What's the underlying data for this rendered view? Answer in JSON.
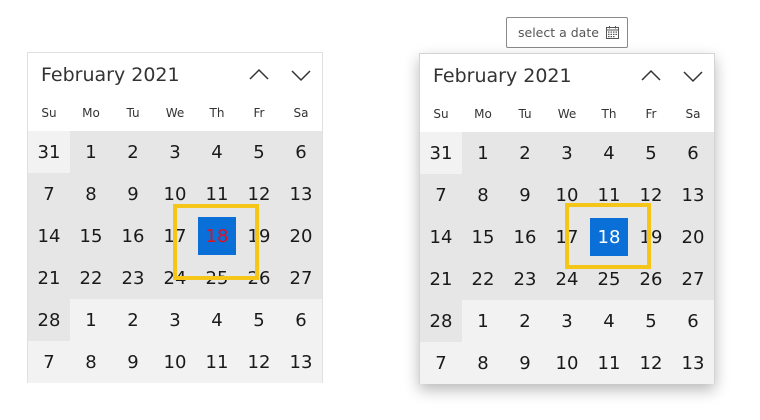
{
  "date_picker": {
    "placeholder": "select a date",
    "icon": "calendar-icon"
  },
  "calendars": [
    {
      "month_title": "February 2021",
      "weekdays": [
        "Su",
        "Mo",
        "Tu",
        "We",
        "Th",
        "Fr",
        "Sa"
      ],
      "days": [
        "31",
        "1",
        "2",
        "3",
        "4",
        "5",
        "6",
        "7",
        "8",
        "9",
        "10",
        "11",
        "12",
        "13",
        "14",
        "15",
        "16",
        "17",
        "18",
        "19",
        "20",
        "21",
        "22",
        "23",
        "24",
        "25",
        "26",
        "27",
        "28",
        "1",
        "2",
        "3",
        "4",
        "5",
        "6",
        "7",
        "8",
        "9",
        "10",
        "11",
        "12",
        "13"
      ],
      "selected": "18",
      "selected_text_color": "#e0101d"
    },
    {
      "month_title": "February 2021",
      "weekdays": [
        "Su",
        "Mo",
        "Tu",
        "We",
        "Th",
        "Fr",
        "Sa"
      ],
      "days": [
        "31",
        "1",
        "2",
        "3",
        "4",
        "5",
        "6",
        "7",
        "8",
        "9",
        "10",
        "11",
        "12",
        "13",
        "14",
        "15",
        "16",
        "17",
        "18",
        "19",
        "20",
        "21",
        "22",
        "23",
        "24",
        "25",
        "26",
        "27",
        "28",
        "1",
        "2",
        "3",
        "4",
        "5",
        "6",
        "7",
        "8",
        "9",
        "10",
        "11",
        "12",
        "13"
      ],
      "selected": "18",
      "selected_text_color": "#ffffff"
    }
  ],
  "colors": {
    "accent": "#0a6fd6",
    "highlight": "#f5c518",
    "in_month_bg": "#e6e6e6",
    "out_month_bg": "#f2f2f2"
  }
}
